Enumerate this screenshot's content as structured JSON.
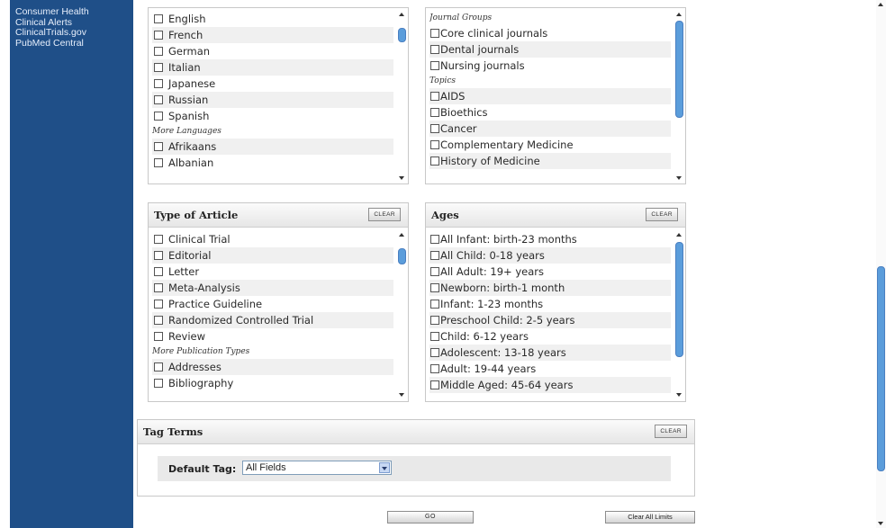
{
  "sidebar": {
    "links": [
      "Consumer Health",
      "Clinical Alerts",
      "ClinicalTrials.gov",
      "PubMed Central"
    ]
  },
  "languages": {
    "items": [
      {
        "label": "English",
        "type": "option"
      },
      {
        "label": "French",
        "type": "option"
      },
      {
        "label": "German",
        "type": "option"
      },
      {
        "label": "Italian",
        "type": "option"
      },
      {
        "label": "Japanese",
        "type": "option"
      },
      {
        "label": "Russian",
        "type": "option"
      },
      {
        "label": "Spanish",
        "type": "option"
      },
      {
        "label": "More Languages",
        "type": "heading"
      },
      {
        "label": "Afrikaans",
        "type": "option"
      },
      {
        "label": "Albanian",
        "type": "option"
      }
    ]
  },
  "subsets": {
    "items": [
      {
        "label": "Journal Groups",
        "type": "heading"
      },
      {
        "label": "Core clinical journals",
        "type": "option"
      },
      {
        "label": "Dental journals",
        "type": "option"
      },
      {
        "label": "Nursing journals",
        "type": "option"
      },
      {
        "label": "Topics",
        "type": "heading"
      },
      {
        "label": "AIDS",
        "type": "option"
      },
      {
        "label": "Bioethics",
        "type": "option"
      },
      {
        "label": "Cancer",
        "type": "option"
      },
      {
        "label": "Complementary Medicine",
        "type": "option"
      },
      {
        "label": "History of Medicine",
        "type": "option"
      }
    ]
  },
  "type_of_article": {
    "title": "Type of Article",
    "clear_label": "CLEAR",
    "items": [
      {
        "label": "Clinical Trial",
        "type": "option"
      },
      {
        "label": "Editorial",
        "type": "option"
      },
      {
        "label": "Letter",
        "type": "option"
      },
      {
        "label": "Meta-Analysis",
        "type": "option"
      },
      {
        "label": "Practice Guideline",
        "type": "option"
      },
      {
        "label": "Randomized Controlled Trial",
        "type": "option"
      },
      {
        "label": "Review",
        "type": "option"
      },
      {
        "label": "More Publication Types",
        "type": "heading"
      },
      {
        "label": "Addresses",
        "type": "option"
      },
      {
        "label": "Bibliography",
        "type": "option"
      }
    ]
  },
  "ages": {
    "title": "Ages",
    "clear_label": "CLEAR",
    "items": [
      {
        "label": "All Infant: birth-23 months",
        "type": "option"
      },
      {
        "label": "All Child: 0-18 years",
        "type": "option"
      },
      {
        "label": "All Adult: 19+ years",
        "type": "option"
      },
      {
        "label": "Newborn: birth-1 month",
        "type": "option"
      },
      {
        "label": "Infant: 1-23 months",
        "type": "option"
      },
      {
        "label": "Preschool Child: 2-5 years",
        "type": "option"
      },
      {
        "label": "Child: 6-12 years",
        "type": "option"
      },
      {
        "label": "Adolescent: 13-18 years",
        "type": "option"
      },
      {
        "label": "Adult: 19-44 years",
        "type": "option"
      },
      {
        "label": "Middle Aged: 45-64 years",
        "type": "option"
      }
    ]
  },
  "tag_terms": {
    "title": "Tag Terms",
    "clear_label": "CLEAR",
    "default_tag_label": "Default Tag:",
    "default_tag_value": "All Fields"
  },
  "actions": {
    "go_label": "GO",
    "clear_all_label": "Clear All Limits"
  },
  "colors": {
    "sidebar_bg": "#1f4f88",
    "scroll_thumb": "#5b9ddb"
  }
}
